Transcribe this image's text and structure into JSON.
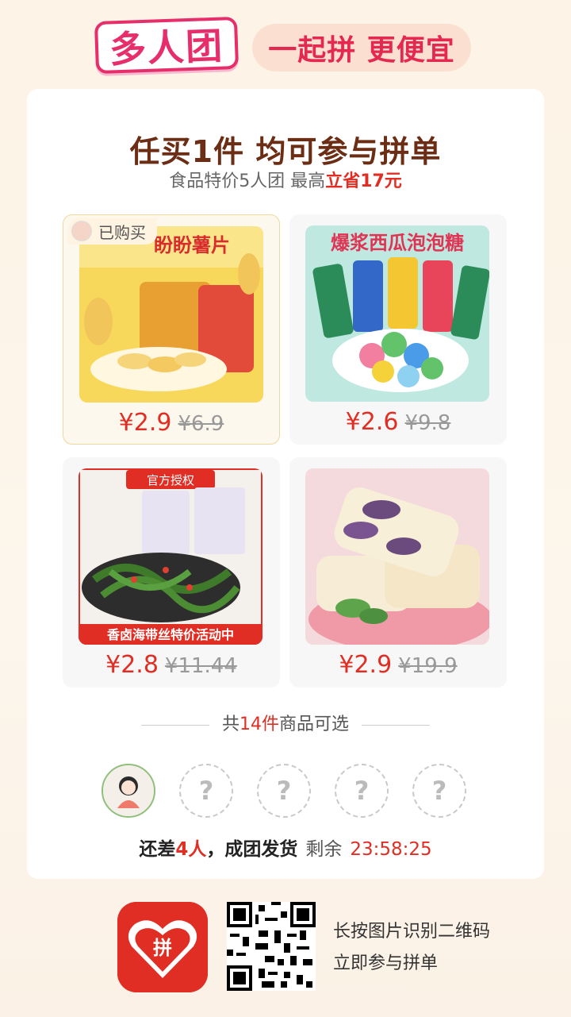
{
  "header": {
    "logo_text": "多人团",
    "slogan": "一起拼 更便宜"
  },
  "main": {
    "title": "任买1件 均可参与拼单",
    "subtitle_prefix": "食品特价5人团 最高",
    "subtitle_highlight": "立省17元"
  },
  "products": [
    {
      "name_text": "盼盼薯片",
      "price": "¥2.9",
      "original_price": "¥6.9",
      "tag": "已购买",
      "bought": true
    },
    {
      "name_text": "爆浆西瓜泡泡糖",
      "price": "¥2.6",
      "original_price": "¥9.8",
      "bought": false
    },
    {
      "name_text": "香卤海带丝特价活动中",
      "badge": "官方授权",
      "price": "¥2.8",
      "original_price": "¥11.44",
      "bought": false
    },
    {
      "name_text": "",
      "price": "¥2.9",
      "original_price": "¥19.9",
      "bought": false
    }
  ],
  "summary": {
    "prefix": "共",
    "count": "14件",
    "suffix": "商品可选"
  },
  "group": {
    "slots": [
      "?",
      "?",
      "?",
      "?"
    ],
    "status_prefix": "还差",
    "status_count": "4人",
    "status_suffix": "，成团发货",
    "remain_label": "剩余",
    "timer": "23:58:25"
  },
  "footer": {
    "line1": "长按图片识别二维码",
    "line2": "立即参与拼单",
    "app_icon_text": "拼"
  },
  "colors": {
    "accent": "#e02e24",
    "brand_pink": "#e62e6b",
    "title_brown": "#6b2d14"
  }
}
